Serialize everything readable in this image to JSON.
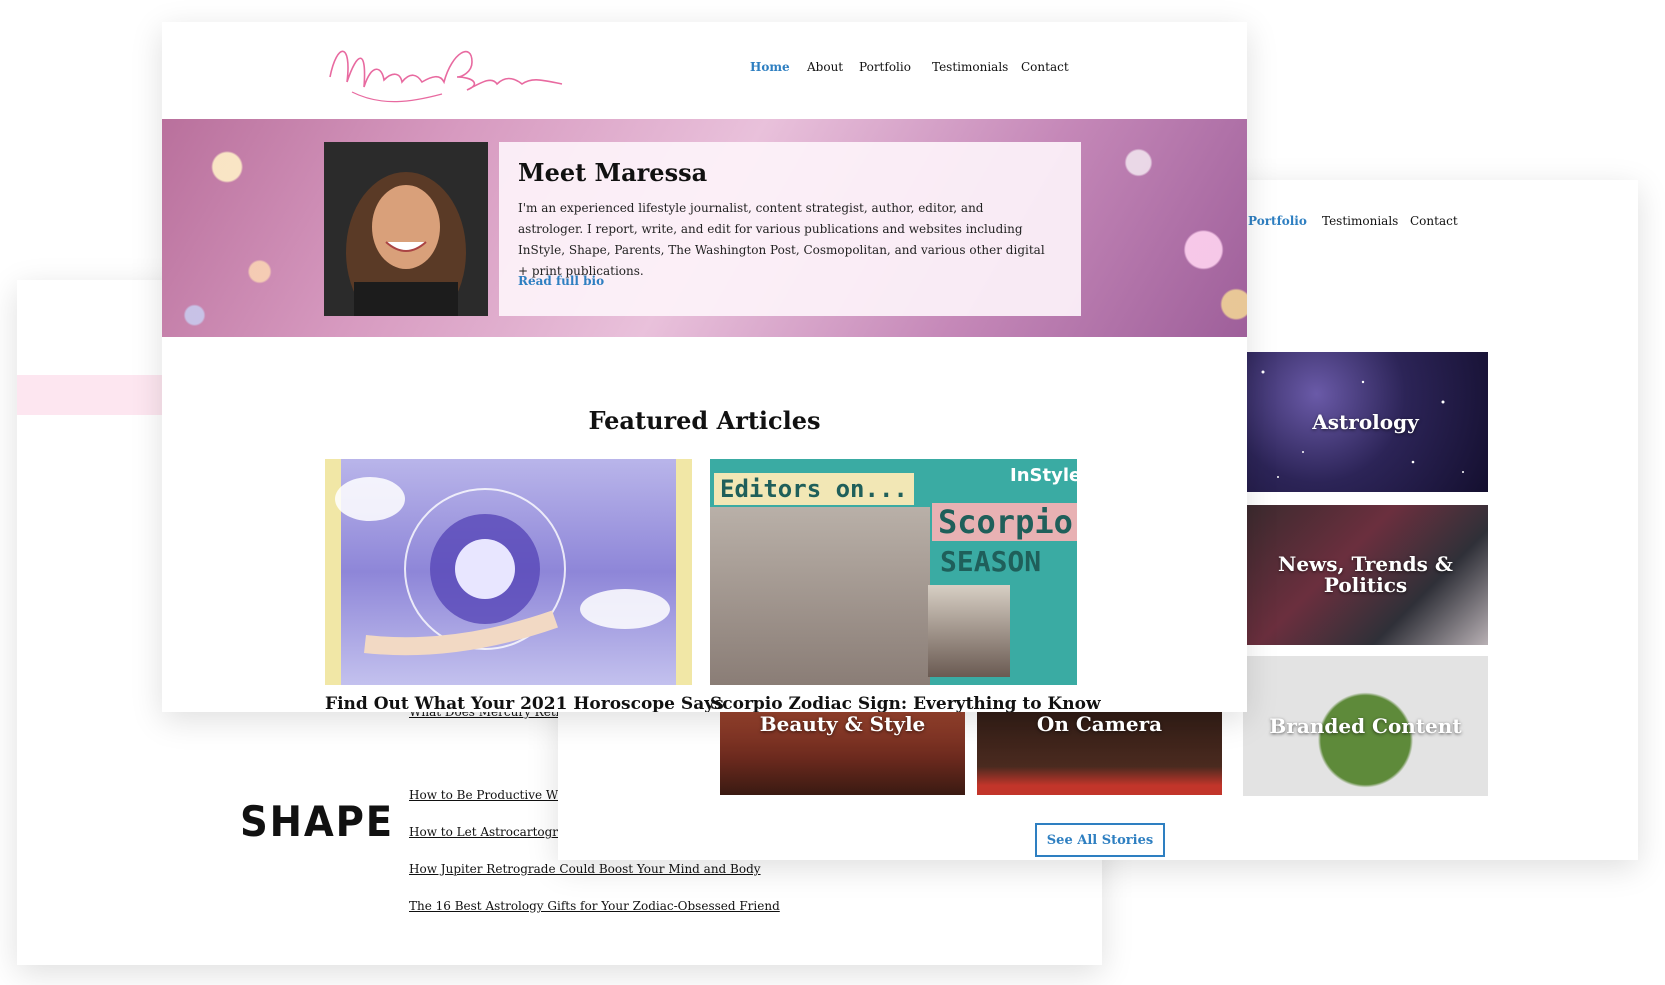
{
  "front": {
    "logo_text": "Maressa Brown",
    "nav": [
      "Home",
      "About",
      "Portfolio",
      "Testimonials",
      "Contact"
    ],
    "nav_active": "Home",
    "hero": {
      "title": "Meet Maressa",
      "text": "I'm an experienced lifestyle journalist, content strategist, author, editor, and astrologer. I report, write, and edit for various publications and websites including InStyle, Shape, Parents, The Washington Post, Cosmopolitan, and various other digital + print publications.",
      "link": "Read full bio"
    },
    "featured": {
      "title": "Featured Articles",
      "articles": [
        {
          "title": "Find Out What Your 2021 Horoscope Says"
        },
        {
          "title": "Scorpio Zodiac Sign: Everything to Know",
          "image_text_1": "Editors on...",
          "image_text_2": "Scorpio",
          "image_text_3": "SEASON",
          "image_brand": "InStyle"
        }
      ]
    }
  },
  "portfolio_card": {
    "nav": [
      "Portfolio",
      "Testimonials",
      "Contact"
    ],
    "nav_active": "Portfolio",
    "categories": [
      "Astrology",
      "News, Trends & Politics",
      "Branded Content",
      "Beauty & Style",
      "On Camera"
    ],
    "button": "See All Stories"
  },
  "shape_card": {
    "publication": "SHAPE",
    "links": [
      "What Does Mercury Retrograde",
      "How to Be Productive While",
      "How to Let Astrocartography Guide Your Wanderlust",
      "How Jupiter Retrograde Could Boost Your Mind and Body",
      "The 16 Best Astrology Gifts for Your Zodiac-Obsessed Friend"
    ]
  },
  "colors": {
    "accent_blue": "#2e7fc1",
    "logo_pink": "#e86aa0",
    "pink_band": "#fde6f0"
  }
}
